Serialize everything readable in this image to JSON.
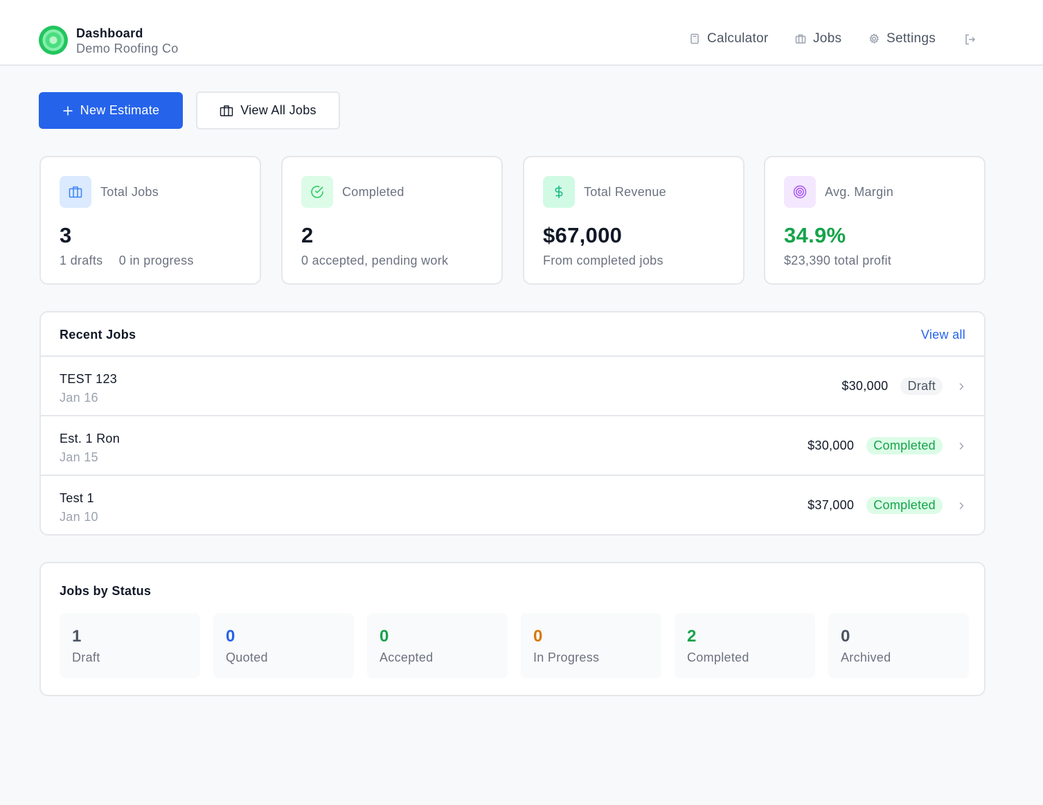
{
  "header": {
    "title": "Dashboard",
    "subtitle": "Demo Roofing Co",
    "nav": {
      "calculator": "Calculator",
      "jobs": "Jobs",
      "settings": "Settings"
    }
  },
  "actions": {
    "new_estimate": "New Estimate",
    "view_all_jobs": "View All Jobs"
  },
  "stats": {
    "total_jobs": {
      "label": "Total Jobs",
      "value": "3",
      "sub_drafts": "1 drafts",
      "sub_in_progress": "0 in progress"
    },
    "completed": {
      "label": "Completed",
      "value": "2",
      "sub": "0 accepted, pending work"
    },
    "revenue": {
      "label": "Total Revenue",
      "value": "$67,000",
      "sub": "From completed jobs"
    },
    "margin": {
      "label": "Avg. Margin",
      "value": "34.9%",
      "sub": "$23,390 total profit"
    }
  },
  "recent_jobs": {
    "title": "Recent Jobs",
    "view_all": "View all",
    "rows": [
      {
        "name": "TEST 123",
        "date": "Jan 16",
        "amount": "$30,000",
        "status": "Draft"
      },
      {
        "name": "Est. 1 Ron",
        "date": "Jan 15",
        "amount": "$30,000",
        "status": "Completed"
      },
      {
        "name": "Test 1",
        "date": "Jan 10",
        "amount": "$37,000",
        "status": "Completed"
      }
    ]
  },
  "jobs_by_status": {
    "title": "Jobs by Status",
    "items": [
      {
        "count": "1",
        "label": "Draft",
        "color": "#4b5563"
      },
      {
        "count": "0",
        "label": "Quoted",
        "color": "#2563eb"
      },
      {
        "count": "0",
        "label": "Accepted",
        "color": "#16a34a"
      },
      {
        "count": "0",
        "label": "In Progress",
        "color": "#d97706"
      },
      {
        "count": "2",
        "label": "Completed",
        "color": "#16a34a"
      },
      {
        "count": "0",
        "label": "Archived",
        "color": "#4b5563"
      }
    ]
  },
  "colors": {
    "accent": "#2563eb",
    "success": "#16a34a",
    "margin_value": "#16a34a",
    "icon_total_jobs_bg": "#dbeafe",
    "icon_completed_bg": "#dcfce7",
    "icon_revenue_bg": "#d1fae5",
    "icon_margin_bg": "#f3e8ff"
  },
  "icons": {
    "logo": "green-circle-logo",
    "calculator": "calculator-icon",
    "jobs": "briefcase-icon",
    "settings": "gear-icon",
    "logout": "logout-icon",
    "new_estimate": "plus-icon",
    "completed": "check-circle-icon",
    "revenue": "dollar-icon",
    "margin": "target-icon",
    "row_chevron": "chevron-right-icon"
  }
}
